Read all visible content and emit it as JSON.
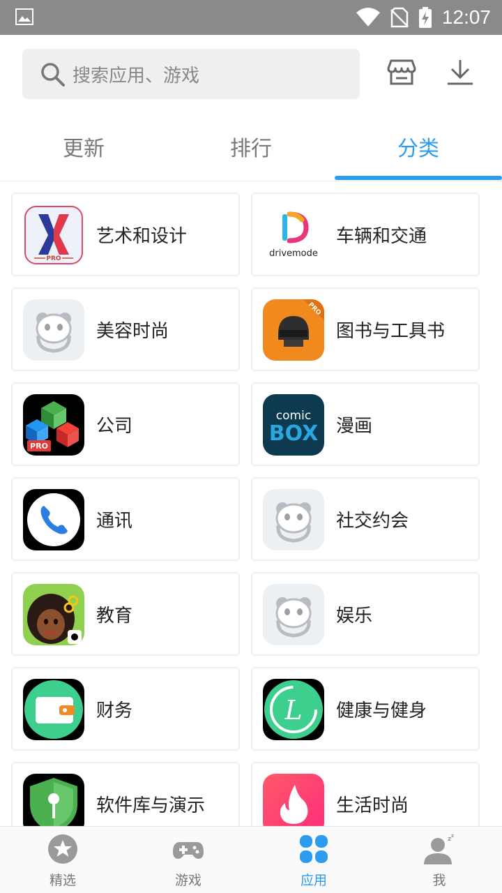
{
  "status_bar": {
    "time": "12:07"
  },
  "header": {
    "search_placeholder": "搜索应用、游戏",
    "icons": [
      "search-icon",
      "store-icon",
      "download-icon"
    ]
  },
  "tabs": [
    {
      "label": "更新",
      "active": false
    },
    {
      "label": "排行",
      "active": false
    },
    {
      "label": "分类",
      "active": true
    }
  ],
  "categories": [
    {
      "label": "艺术和设计",
      "icon": "x-launcher-pro-app-icon"
    },
    {
      "label": "车辆和交通",
      "icon": "drivemode-app-icon",
      "icon_text": "drivemode"
    },
    {
      "label": "美容时尚",
      "icon": "panda-placeholder-icon"
    },
    {
      "label": "图书与工具书",
      "icon": "helmet-pro-app-icon",
      "icon_text": "PRO"
    },
    {
      "label": "公司",
      "icon": "office-suite-pro-app-icon",
      "icon_text": "PRO"
    },
    {
      "label": "漫画",
      "icon": "comicbox-app-icon",
      "icon_text": "comic BOX"
    },
    {
      "label": "通讯",
      "icon": "phone-app-icon"
    },
    {
      "label": "社交约会",
      "icon": "panda-placeholder-icon"
    },
    {
      "label": "教育",
      "icon": "hair-salon-app-icon"
    },
    {
      "label": "娱乐",
      "icon": "panda-placeholder-icon"
    },
    {
      "label": "财务",
      "icon": "wallet-app-icon"
    },
    {
      "label": "健康与健身",
      "icon": "lifesum-app-icon"
    },
    {
      "label": "软件库与演示",
      "icon": "shield-mic-app-icon"
    },
    {
      "label": "生活时尚",
      "icon": "tinder-flame-app-icon"
    }
  ],
  "bottom_nav": [
    {
      "label": "精选",
      "icon": "star-icon",
      "active": false
    },
    {
      "label": "游戏",
      "icon": "gamepad-icon",
      "active": false
    },
    {
      "label": "应用",
      "icon": "apps-grid-icon",
      "active": true
    },
    {
      "label": "我",
      "icon": "user-sleep-icon",
      "active": false
    }
  ],
  "colors": {
    "accent": "#2b9cf0",
    "status_bar": "#8a8a8a",
    "search_bg": "#efefef"
  }
}
